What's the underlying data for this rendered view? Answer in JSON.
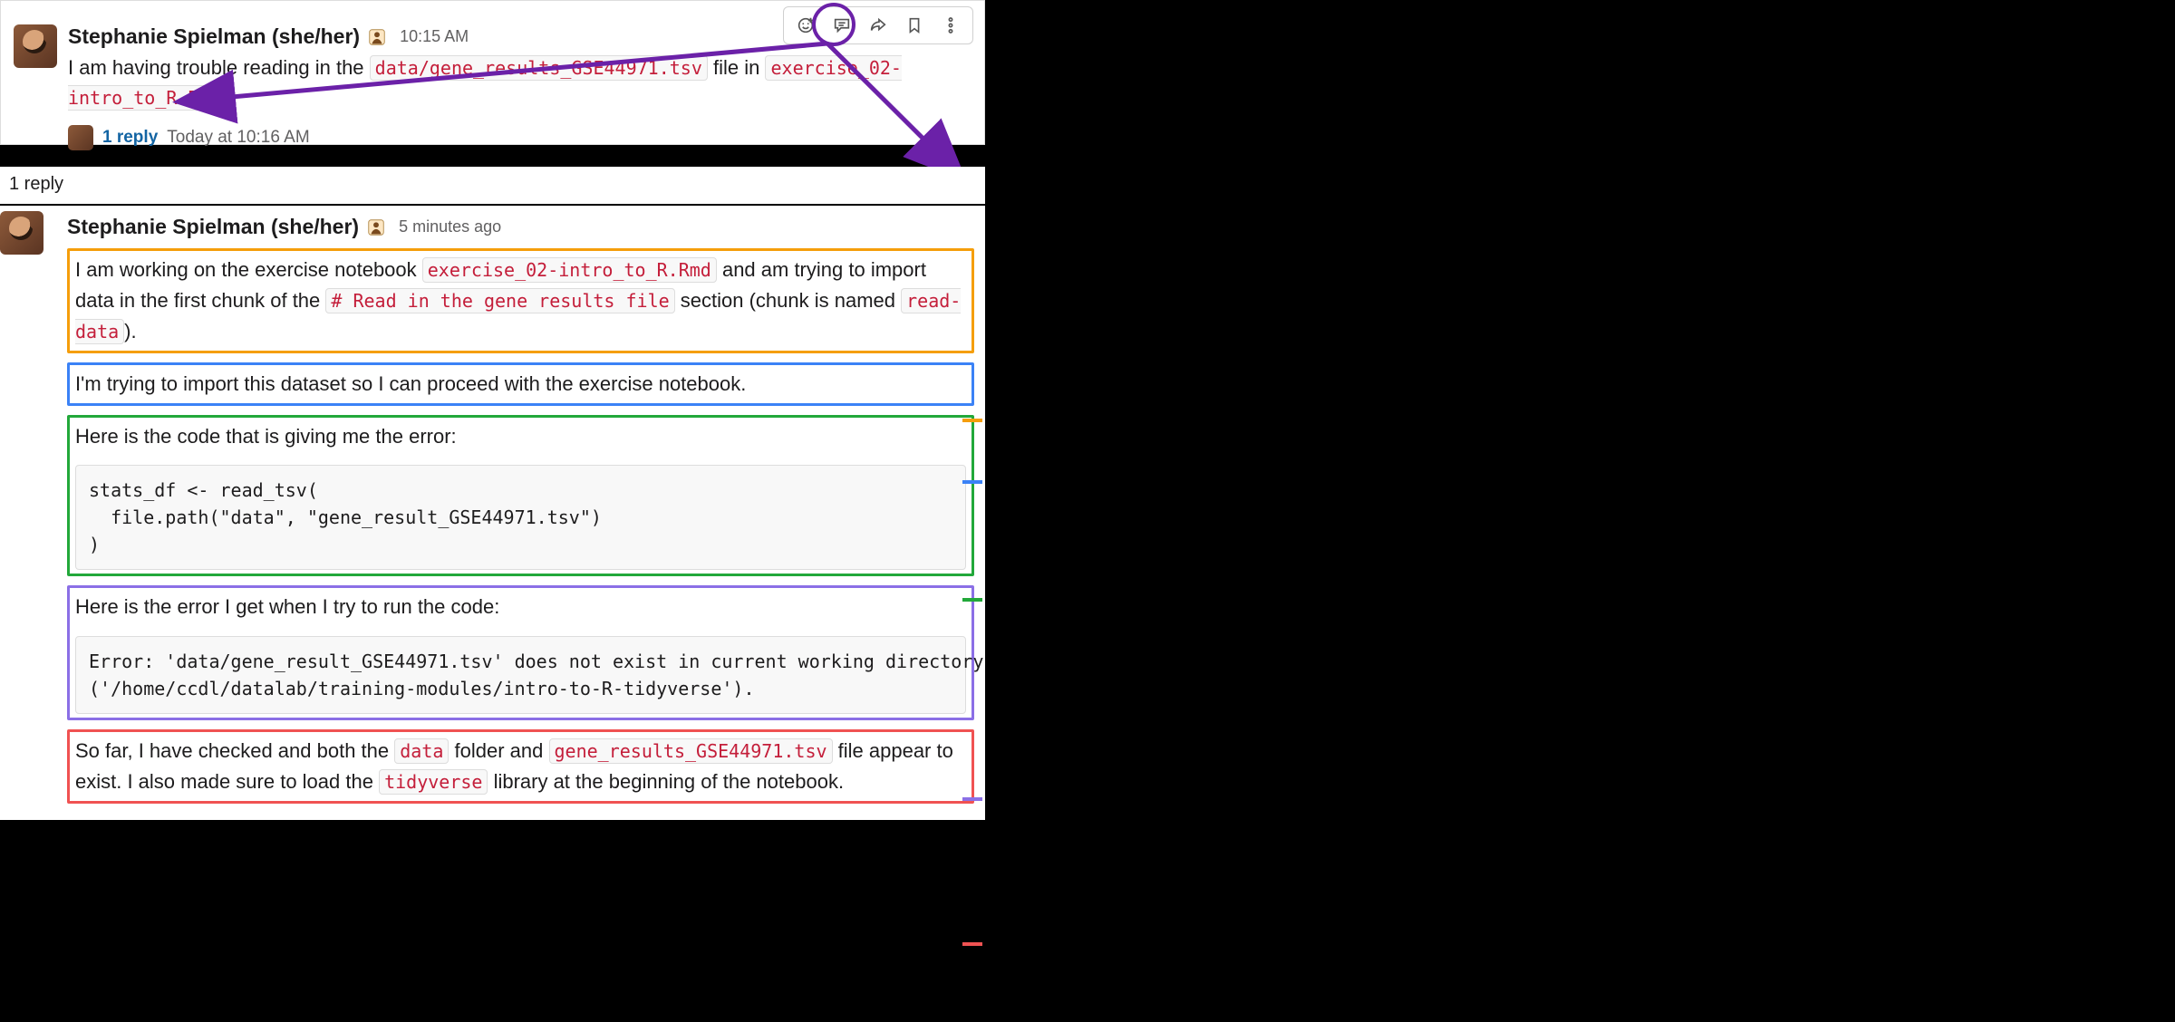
{
  "top": {
    "author": "Stephanie Spielman (she/her)",
    "time": "10:15 AM",
    "text_before_code1": "I am having trouble reading in the ",
    "code1": "data/gene_results_GSE44971.tsv",
    "text_mid": " file in ",
    "code2": "exercise_02-intro_to_R.Rmd",
    "reply_link": "1 reply",
    "reply_time": "Today at 10:16 AM"
  },
  "thread": {
    "header": "1 reply",
    "author": "Stephanie Spielman (she/her)",
    "time": "5 minutes ago",
    "orange": {
      "p1a": "I am working on the exercise notebook ",
      "code1": "exercise_02-intro_to_R.Rmd",
      "p1b": " and am trying to import data in the first chunk of the ",
      "code2": "# Read in the gene results file",
      "p1c": " section (chunk is named ",
      "code3": "read-data",
      "p1d": ")."
    },
    "blue": "I'm trying to import this dataset so I can proceed with the exercise notebook.",
    "green": {
      "intro": "Here is the code that is giving me the error:",
      "code": "stats_df <- read_tsv(\n  file.path(\"data\", \"gene_result_GSE44971.tsv\")\n)"
    },
    "purple": {
      "intro": "Here is the error I get when I try to run the code:",
      "code": "Error: 'data/gene_result_GSE44971.tsv' does not exist in current working directory \n('/home/ccdl/datalab/training-modules/intro-to-R-tidyverse')."
    },
    "red": {
      "a": "So far, I have checked and both the ",
      "code1": "data",
      "b": " folder and ",
      "code2": "gene_results_GSE44971.tsv",
      "c": " file appear to exist. I also made sure to load the ",
      "code3": "tidyverse",
      "d": " library at the beginning of the notebook."
    }
  }
}
